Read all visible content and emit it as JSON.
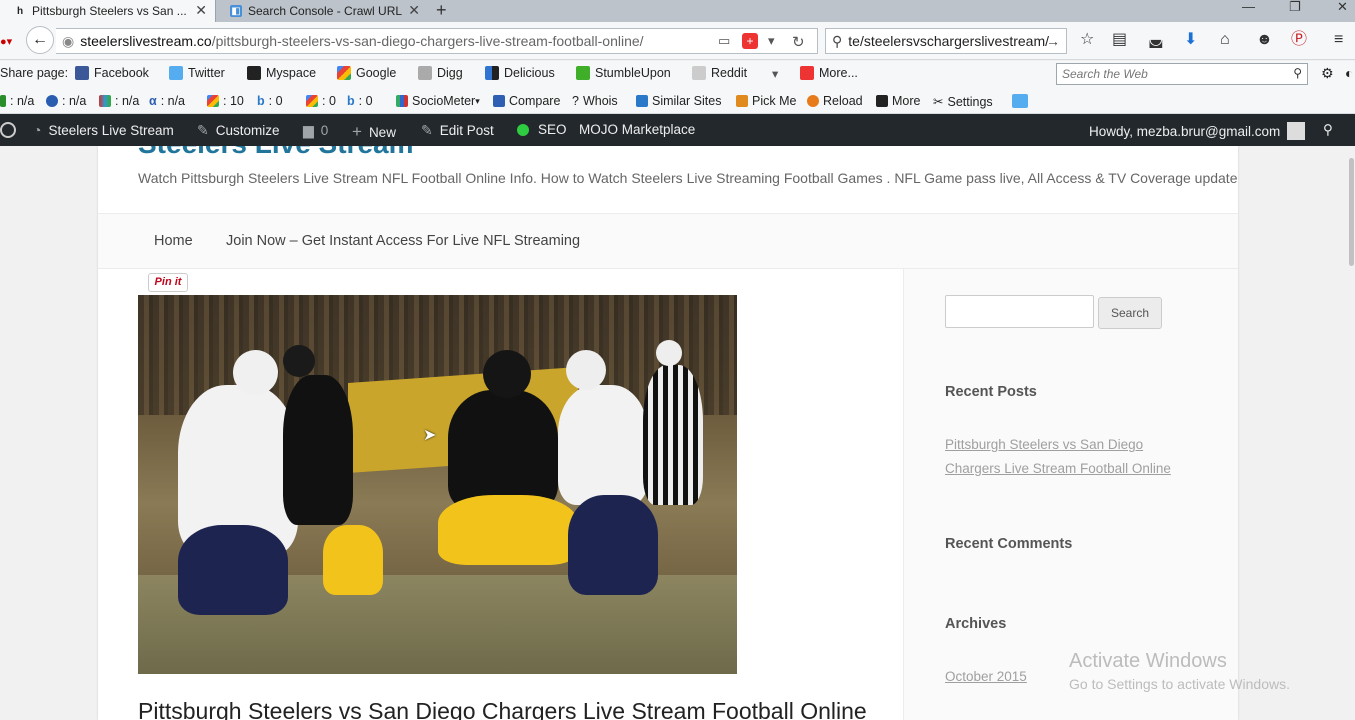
{
  "browser": {
    "tabs": [
      {
        "title": "Pittsburgh Steelers vs San ...",
        "icon": "wordpress-icon"
      },
      {
        "title": "Search Console - Crawl URL",
        "icon": "search-console-icon"
      }
    ],
    "url_host": "steelerslivestream.co",
    "url_path": "/pittsburgh-steelers-vs-san-diego-chargers-live-stream-football-online/",
    "search_value": "te/steelersvschargerslivestream/"
  },
  "sharebar": {
    "label": "Share page:",
    "items": [
      "Facebook",
      "Twitter",
      "Myspace",
      "Google",
      "Digg",
      "Delicious",
      "StumbleUpon",
      "Reddit",
      "More..."
    ],
    "web_search_placeholder": "Search the Web"
  },
  "seobar": {
    "items": [
      ": n/a",
      ": n/a",
      ": n/a",
      ": n/a",
      ": 10",
      ": 0",
      ": 0",
      ": 0",
      "SocioMeter",
      "Compare",
      "Whois",
      "Similar Sites",
      "Pick Me",
      "Reload",
      "More",
      "Settings"
    ]
  },
  "adminbar": {
    "site_name": "Steelers Live Stream",
    "customize": "Customize",
    "comments_count": "0",
    "new": "New",
    "edit_post": "Edit Post",
    "seo": "SEO",
    "marketplace": "MOJO Marketplace",
    "greeting": "Howdy, mezba.brur@gmail.com"
  },
  "site": {
    "title": "Steelers Live Stream",
    "tagline": "Watch Pittsburgh Steelers Live Stream NFL Football Online Info. How to Watch Steelers Live Streaming Football Games . NFL Game pass live, All Access & TV Coverage update",
    "menu": [
      "Home",
      "Join Now – Get Instant Access For Live NFL Streaming"
    ],
    "pinit": "Pin it",
    "post_title": "Pittsburgh Steelers vs San Diego Chargers Live Stream Football Online"
  },
  "sidebar": {
    "search_button": "Search",
    "recent_posts_heading": "Recent Posts",
    "recent_post_link": "Pittsburgh Steelers vs San Diego Chargers Live Stream Football Online",
    "recent_comments_heading": "Recent Comments",
    "archives_heading": "Archives",
    "archive_link": "October 2015"
  },
  "watermark": {
    "line1": "Activate Windows",
    "line2": "Go to Settings to activate Windows."
  },
  "colors": {
    "admin_bar": "#23282d",
    "site_title": "#21759b",
    "seo_dot": "#2ecc40"
  }
}
